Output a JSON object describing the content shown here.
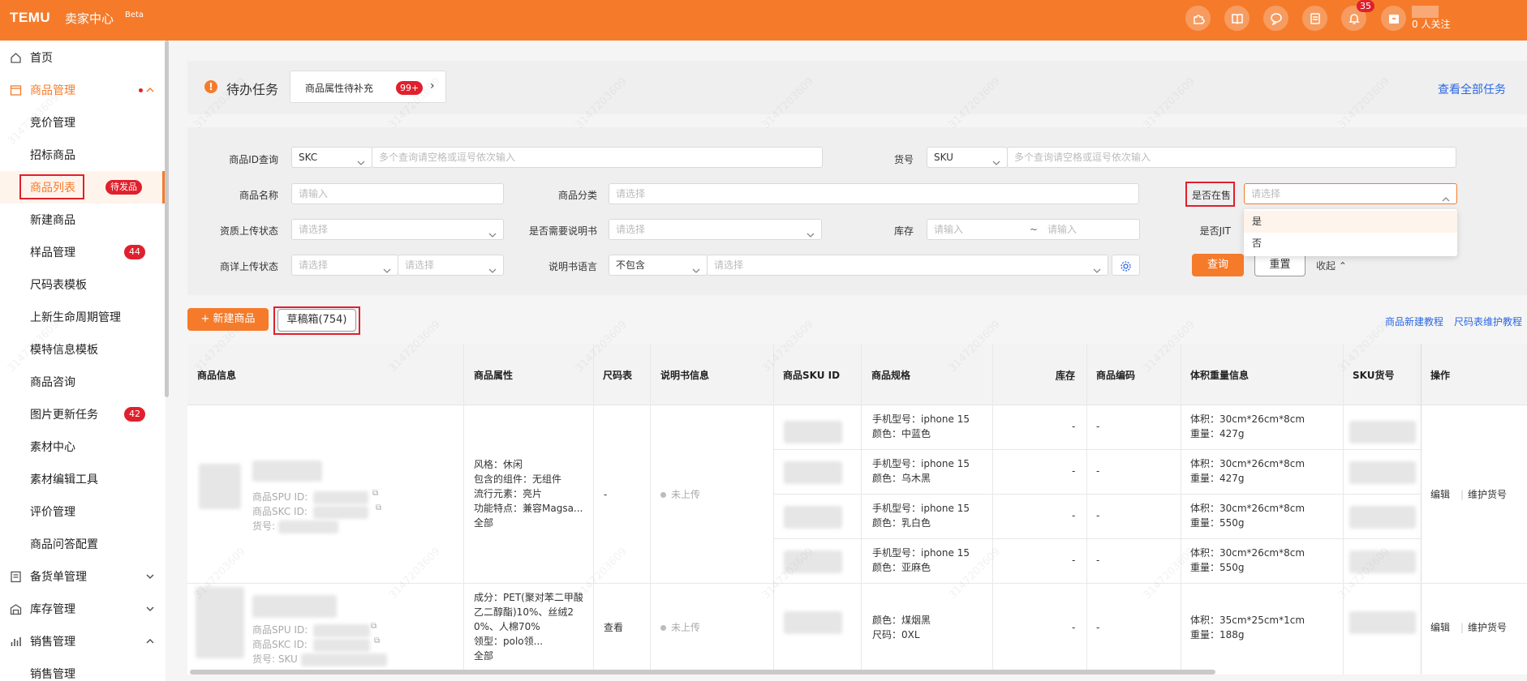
{
  "topbar": {
    "logo": "TEMU",
    "brand": "卖家中心",
    "beta": "Beta",
    "notif_count": "35",
    "follow": "0 人关注",
    "icons": [
      "puzzle-icon",
      "book-icon",
      "chat-icon",
      "clipboard-icon",
      "bell-icon",
      "store-icon"
    ]
  },
  "sidebar": {
    "items": [
      {
        "label": "首页"
      },
      {
        "label": "商品管理",
        "badge": ""
      },
      {
        "label": "竞价管理"
      },
      {
        "label": "招标商品"
      },
      {
        "label": "商品列表",
        "tag": "待发品"
      },
      {
        "label": "新建商品"
      },
      {
        "label": "样品管理",
        "count": "44"
      },
      {
        "label": "尺码表模板"
      },
      {
        "label": "上新生命周期管理"
      },
      {
        "label": "模特信息模板"
      },
      {
        "label": "商品咨询"
      },
      {
        "label": "图片更新任务",
        "count": "42"
      },
      {
        "label": "素材中心"
      },
      {
        "label": "素材编辑工具"
      },
      {
        "label": "评价管理"
      },
      {
        "label": "商品问答配置"
      },
      {
        "label": "备货单管理"
      },
      {
        "label": "库存管理"
      },
      {
        "label": "销售管理"
      },
      {
        "label": "销售管理"
      }
    ]
  },
  "tasks": {
    "title": "待办任务",
    "card_label": "商品属性待补充",
    "card_badge": "99+",
    "view_all": "查看全部任务"
  },
  "filters": {
    "product_id_label": "商品ID查询",
    "product_id_type": "SKC",
    "product_id_placeholder": "多个查询请空格或逗号依次输入",
    "sku_code_label": "货号",
    "sku_code_type": "SKU",
    "sku_code_placeholder": "多个查询请空格或逗号依次输入",
    "name_label": "商品名称",
    "name_placeholder": "请输入",
    "category_label": "商品分类",
    "category_placeholder": "请选择",
    "on_sale_label": "是否在售",
    "on_sale_placeholder": "请选择",
    "qual_label": "资质上传状态",
    "qual_placeholder": "请选择",
    "manual_need_label": "是否需要说明书",
    "manual_need_placeholder": "请选择",
    "stock_label": "库存",
    "stock_from": "请输入",
    "stock_sep": "~",
    "stock_to": "请输入",
    "jit_label": "是否JIT",
    "detail_label": "商详上传状态",
    "detail_placeholder1": "请选择",
    "detail_placeholder2": "请选择",
    "manual_lang_label": "说明书语言",
    "manual_lang_mode": "不包含",
    "manual_lang_placeholder": "请选择",
    "search_btn": "查询",
    "reset_btn": "重置",
    "collapse": "收起",
    "dropdown_options": [
      "是",
      "否"
    ]
  },
  "actions": {
    "new_product": "+ 新建商品",
    "drafts": "草稿箱(754)",
    "tutorial1": "商品新建教程",
    "tutorial2": "尺码表维护教程"
  },
  "table": {
    "headers": [
      "商品信息",
      "商品属性",
      "尺码表",
      "说明书信息",
      "商品SKU ID",
      "商品规格",
      "库存",
      "商品编码",
      "体积重量信息",
      "SKU货号",
      "操作"
    ],
    "info_labels": {
      "spu": "商品SPU ID:",
      "skc": "商品SKC ID:",
      "code": "货号:",
      "code2": "货号: SKU"
    },
    "rows": [
      {
        "attrs": [
          "风格：休闲",
          "包含的组件：无组件",
          "流行元素：亮片",
          "功能特点：兼容Magsa..."
        ],
        "attrs_all": "全部",
        "size_chart": "-",
        "manual": "未上传",
        "skus": [
          {
            "spec1": "手机型号：iphone 15",
            "spec2": "颜色：中蓝色",
            "stock": "-",
            "code": "-",
            "vol": "体积：30cm*26cm*8cm",
            "weight": "重量：427g"
          },
          {
            "spec1": "手机型号：iphone 15",
            "spec2": "颜色：乌木黑",
            "stock": "-",
            "code": "-",
            "vol": "体积：30cm*26cm*8cm",
            "weight": "重量：427g"
          },
          {
            "spec1": "手机型号：iphone 15",
            "spec2": "颜色：乳白色",
            "stock": "-",
            "code": "-",
            "vol": "体积：30cm*26cm*8cm",
            "weight": "重量：550g"
          },
          {
            "spec1": "手机型号：iphone 15",
            "spec2": "颜色：亚麻色",
            "stock": "-",
            "code": "-",
            "vol": "体积：30cm*26cm*8cm",
            "weight": "重量：550g"
          }
        ],
        "edit": "编辑",
        "maintain": "维护货号"
      },
      {
        "attrs": [
          "成分：PET(聚对苯二甲酸",
          "乙二醇酯)10%、丝绒2",
          "0%、人棉70%",
          "领型：polo领..."
        ],
        "attrs_all": "全部",
        "size_chart": "查看",
        "manual": "未上传",
        "skus": [
          {
            "spec1": "颜色：煤烟黑",
            "spec2": "尺码：0XL",
            "stock": "-",
            "code": "-",
            "vol": "体积：35cm*25cm*1cm",
            "weight": "重量：188g"
          }
        ],
        "edit": "编辑",
        "maintain": "维护货号"
      }
    ]
  },
  "watermark": "3147203609"
}
